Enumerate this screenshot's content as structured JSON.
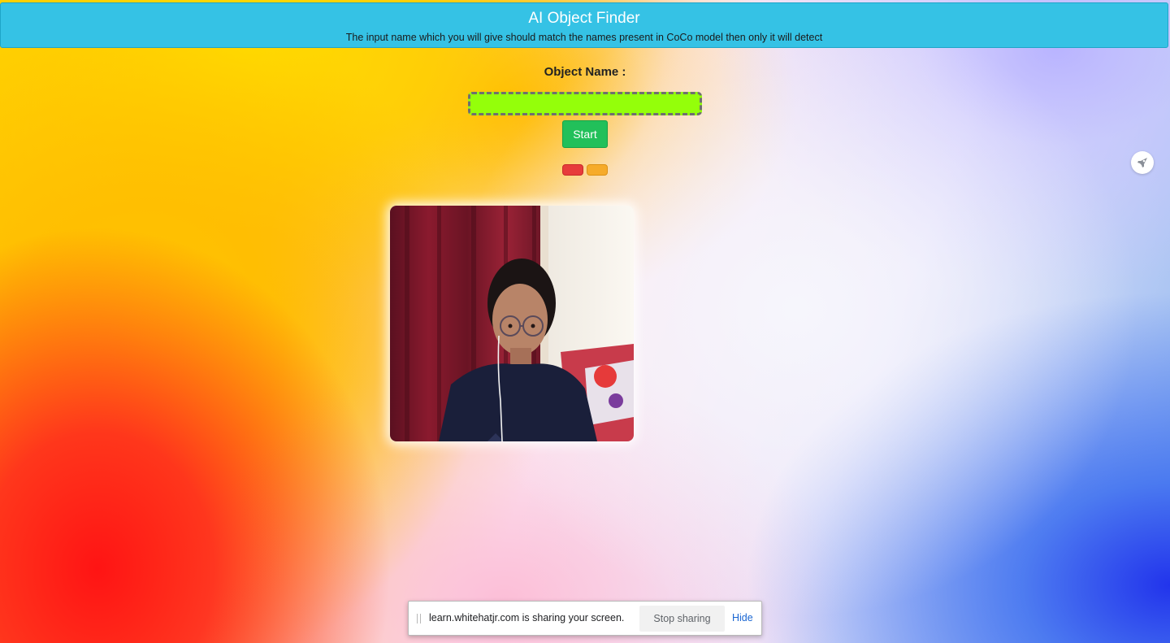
{
  "header": {
    "title": "AI Object Finder",
    "subtitle": "The input name which you will give should match the names present in CoCo model then only it will detect"
  },
  "form": {
    "label": "Object Name :",
    "input_value": "",
    "start_label": "Start"
  },
  "indicators": {
    "red": "#e73b3b",
    "orange": "#f6ab2a"
  },
  "side_icon": "extension-rocket-icon",
  "webcam": {
    "content": "live-webcam-feed"
  },
  "share_bar": {
    "message": "learn.whitehatjr.com is sharing your screen.",
    "stop_label": "Stop sharing",
    "hide_label": "Hide"
  },
  "colors": {
    "header_bg": "#35c2e5",
    "input_bg": "#94ff0a",
    "start_bg": "#22c05a"
  }
}
